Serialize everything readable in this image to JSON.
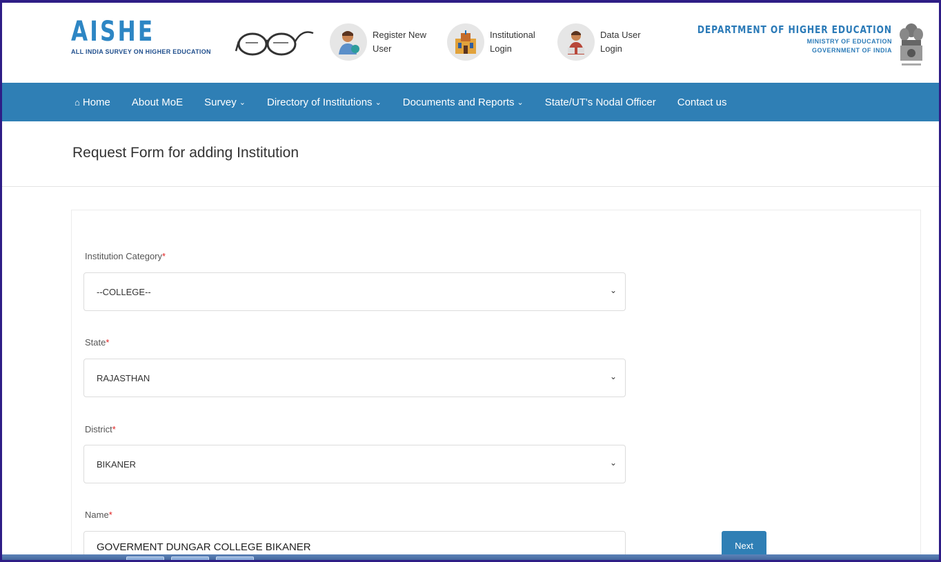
{
  "header": {
    "logo_title": "AISHE",
    "logo_subtitle": "ALL INDIA SURVEY ON HIGHER EDUCATION",
    "links": [
      {
        "label_1": "Register New",
        "label_2": "User",
        "icon": "register-user-icon"
      },
      {
        "label_1": "Institutional",
        "label_2": "Login",
        "icon": "institution-building-icon"
      },
      {
        "label_1": "Data User",
        "label_2": "Login",
        "icon": "data-user-icon"
      }
    ],
    "department": "DEPARTMENT OF HIGHER EDUCATION",
    "ministry": "MINISTRY OF EDUCATION",
    "government": "GOVERNMENT OF INDIA"
  },
  "nav": {
    "items": [
      {
        "label": "Home",
        "dropdown": false
      },
      {
        "label": "About MoE",
        "dropdown": false
      },
      {
        "label": "Survey",
        "dropdown": true
      },
      {
        "label": "Directory of Institutions",
        "dropdown": true
      },
      {
        "label": "Documents and Reports",
        "dropdown": true
      },
      {
        "label": "State/UT's Nodal Officer",
        "dropdown": false
      },
      {
        "label": "Contact us",
        "dropdown": false
      }
    ]
  },
  "page": {
    "title": "Request Form for adding Institution"
  },
  "form": {
    "category_label": "Institution Category",
    "category_value": "--COLLEGE--",
    "state_label": "State",
    "state_value": "RAJASTHAN",
    "district_label": "District",
    "district_value": "BIKANER",
    "name_label": "Name",
    "name_value": "GOVERMENT DUNGAR COLLEGE BIKANER",
    "required_mark": "*",
    "next_label": "Next"
  },
  "colors": {
    "nav_bg": "#2f7fb5",
    "logo_blue": "#2d86c4",
    "required_red": "#e02020"
  }
}
